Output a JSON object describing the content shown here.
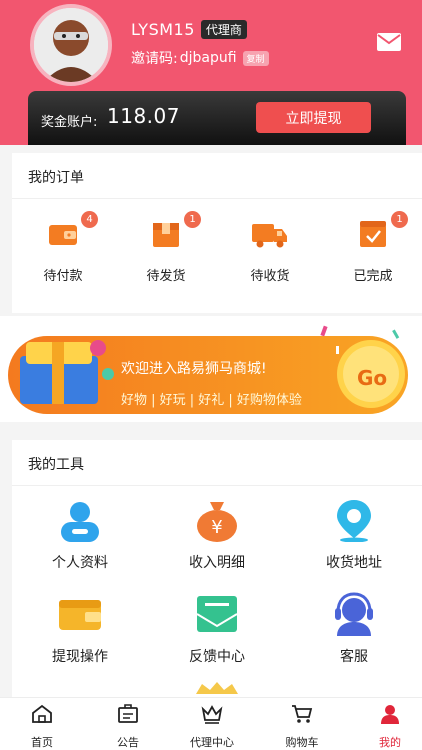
{
  "user": {
    "name": "LYSM15",
    "role": "代理商",
    "invite_label": "邀请码:",
    "invite_code": "djbapufi",
    "copy_label": "复制"
  },
  "balance": {
    "label": "奖金账户:",
    "value": "118.07",
    "withdraw_label": "立即提现"
  },
  "orders": {
    "title": "我的订单",
    "items": [
      {
        "label": "待付款",
        "badge": "4",
        "icon": "wallet-icon"
      },
      {
        "label": "待发货",
        "badge": "1",
        "icon": "box-icon"
      },
      {
        "label": "待收货",
        "badge": "",
        "icon": "truck-icon"
      },
      {
        "label": "已完成",
        "badge": "1",
        "icon": "check-box-icon"
      }
    ]
  },
  "banner": {
    "text": "欢迎进入路易狮马商城!",
    "tags": "好物 | 好玩 | 好礼 | 好购物体验",
    "go": "Go"
  },
  "tools": {
    "title": "我的工具",
    "items": [
      {
        "label": "个人资料",
        "icon": "profile-icon"
      },
      {
        "label": "收入明细",
        "icon": "money-bag-icon"
      },
      {
        "label": "收货地址",
        "icon": "location-pin-icon"
      },
      {
        "label": "提现操作",
        "icon": "wallet-icon"
      },
      {
        "label": "反馈中心",
        "icon": "feedback-mail-icon"
      },
      {
        "label": "客服",
        "icon": "headset-icon"
      }
    ]
  },
  "nav": {
    "items": [
      {
        "label": "首页",
        "icon": "home-icon"
      },
      {
        "label": "公告",
        "icon": "notice-icon"
      },
      {
        "label": "代理中心",
        "icon": "crown-icon"
      },
      {
        "label": "购物车",
        "icon": "cart-icon"
      },
      {
        "label": "我的",
        "icon": "user-icon",
        "active": true
      }
    ]
  },
  "colors": {
    "header": "#f2566f",
    "accent": "#ef4f4f",
    "active_nav": "#e0263a",
    "banner": "#f79a1e"
  }
}
